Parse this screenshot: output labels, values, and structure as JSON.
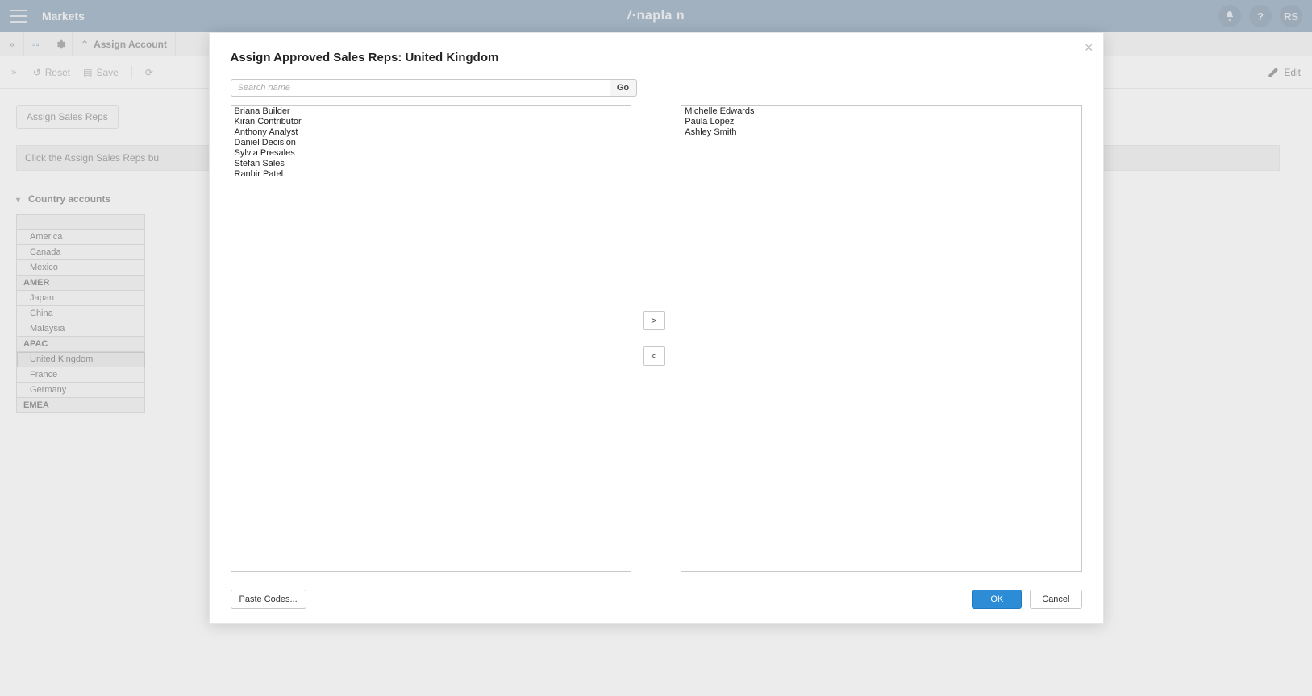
{
  "topbar": {
    "title": "Markets",
    "brand": "napla n",
    "user_initials": "RS"
  },
  "subbar": {
    "crumb": "Assign Account"
  },
  "toolbar": {
    "reset": "Reset",
    "save": "Save",
    "edit": "Edit"
  },
  "body": {
    "assign_btn": "Assign Sales Reps",
    "hint": "Click the Assign Sales Reps bu",
    "section": "Country accounts",
    "rows": [
      {
        "label": "",
        "head": true
      },
      {
        "label": "America",
        "indent": true
      },
      {
        "label": "Canada",
        "indent": true
      },
      {
        "label": "Mexico",
        "indent": true
      },
      {
        "label": "AMER",
        "bold": true
      },
      {
        "label": "Japan",
        "indent": true
      },
      {
        "label": "China",
        "indent": true
      },
      {
        "label": "Malaysia",
        "indent": true
      },
      {
        "label": "APAC",
        "bold": true
      },
      {
        "label": "United Kingdom",
        "indent": true,
        "selected": true
      },
      {
        "label": "France",
        "indent": true
      },
      {
        "label": "Germany",
        "indent": true
      },
      {
        "label": "EMEA",
        "bold": true
      }
    ]
  },
  "modal": {
    "title": "Assign Approved Sales Reps: United Kingdom",
    "search_placeholder": "Search name",
    "go_label": "Go",
    "available": [
      "Briana Builder",
      "Kiran Contributor",
      "Anthony Analyst",
      "Daniel Decision",
      "Sylvia Presales",
      "Stefan Sales",
      "Ranbir Patel"
    ],
    "assigned": [
      "Michelle Edwards",
      "Paula Lopez",
      "Ashley Smith"
    ],
    "move_right": ">",
    "move_left": "<",
    "paste_codes": "Paste Codes...",
    "ok": "OK",
    "cancel": "Cancel"
  }
}
